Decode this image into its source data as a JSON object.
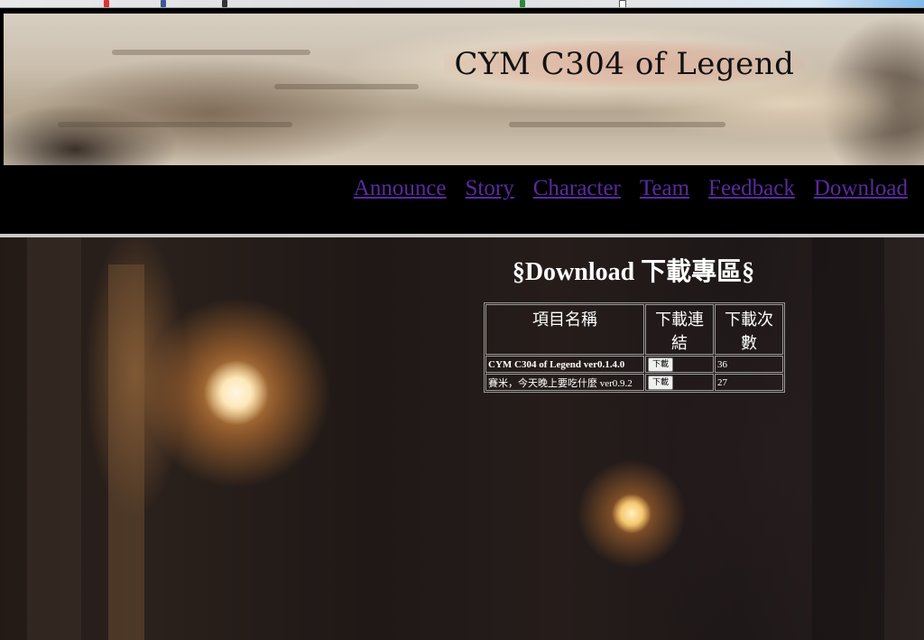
{
  "banner": {
    "title": "CYM C304 of Legend"
  },
  "nav": {
    "items": [
      {
        "label": "Announce"
      },
      {
        "label": "Story"
      },
      {
        "label": "Character"
      },
      {
        "label": "Team"
      },
      {
        "label": "Feedback"
      },
      {
        "label": "Download"
      }
    ],
    "link_color": "#5a2a9e"
  },
  "download": {
    "heading": "§Download 下載專區§",
    "columns": {
      "name": "項目名稱",
      "link": "下載連結",
      "count": "下載次數"
    },
    "rows": [
      {
        "name": "CYM C304 of Legend ver0.1.4.0",
        "button": "下載",
        "count": "36"
      },
      {
        "name": "賽米，今天晚上要吃什麼 ver0.9.2",
        "button": "下載",
        "count": "27"
      }
    ]
  }
}
